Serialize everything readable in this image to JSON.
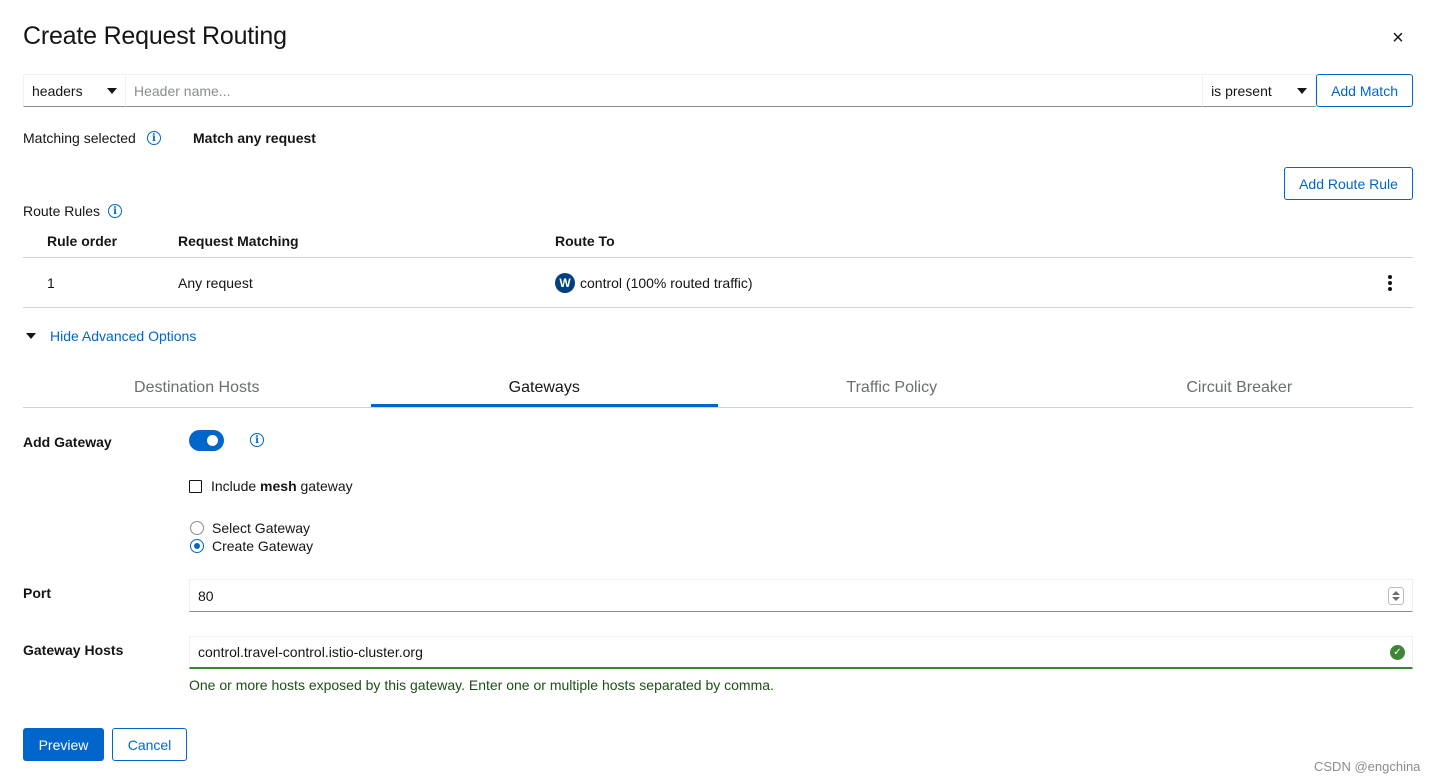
{
  "title": "Create Request Routing",
  "close_label": "×",
  "match": {
    "type_value": "headers",
    "header_placeholder": "Header name...",
    "operator_value": "is present",
    "add_match_label": "Add Match"
  },
  "matching_selected": {
    "label": "Matching selected",
    "value": "Match any request"
  },
  "add_route_rule_label": "Add Route Rule",
  "route_rules": {
    "label": "Route Rules",
    "columns": [
      "Rule order",
      "Request Matching",
      "Route To"
    ],
    "rows": [
      {
        "order": "1",
        "matching": "Any request",
        "badge": "W",
        "route_to": "control (100% routed traffic)"
      }
    ]
  },
  "advanced_toggle_label": "Hide Advanced Options",
  "tabs": [
    {
      "label": "Destination Hosts",
      "active": false
    },
    {
      "label": "Gateways",
      "active": true
    },
    {
      "label": "Traffic Policy",
      "active": false
    },
    {
      "label": "Circuit Breaker",
      "active": false
    }
  ],
  "gateway": {
    "add_gateway_label": "Add Gateway",
    "add_gateway_on": true,
    "include_mesh_prefix": "Include ",
    "include_mesh_bold": "mesh",
    "include_mesh_suffix": " gateway",
    "include_mesh_checked": false,
    "radio_options": [
      {
        "label": "Select Gateway",
        "selected": false
      },
      {
        "label": "Create Gateway",
        "selected": true
      }
    ],
    "port_label": "Port",
    "port_value": "80",
    "hosts_label": "Gateway Hosts",
    "hosts_value": "control.travel-control.istio-cluster.org",
    "hosts_helper": "One or more hosts exposed by this gateway. Enter one or multiple hosts separated by comma."
  },
  "actions": {
    "preview_label": "Preview",
    "cancel_label": "Cancel"
  },
  "watermark": "CSDN @engchina",
  "colors": {
    "primary": "#0066cc",
    "success": "#3e8635",
    "badge": "#004080"
  }
}
